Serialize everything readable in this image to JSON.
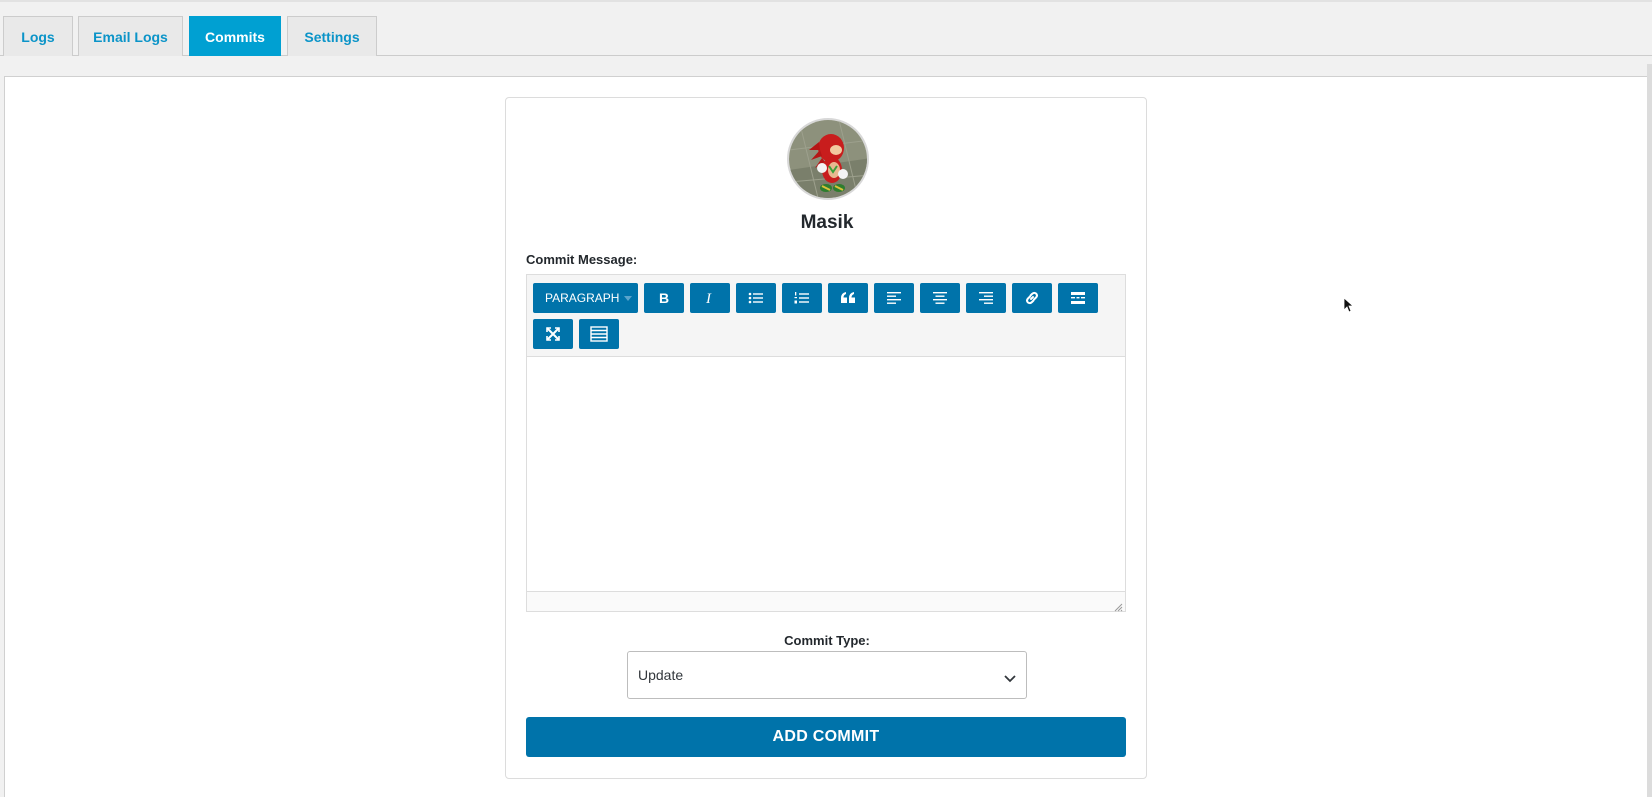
{
  "tabs": [
    {
      "label": "Logs",
      "active": false
    },
    {
      "label": "Email Logs",
      "active": false
    },
    {
      "label": "Commits",
      "active": true
    },
    {
      "label": "Settings",
      "active": false
    }
  ],
  "profile": {
    "username": "Masik"
  },
  "form": {
    "commit_message_label": "Commit Message:",
    "editor": {
      "format_select": "PARAGRAPH",
      "buttons": [
        "bold-icon",
        "italic-icon",
        "bulleted-list-icon",
        "numbered-list-icon",
        "blockquote-icon",
        "align-left-icon",
        "align-center-icon",
        "align-right-icon",
        "link-icon",
        "read-more-icon",
        "fullscreen-icon",
        "toolbar-toggle-icon"
      ],
      "content": ""
    },
    "commit_type_label": "Commit Type:",
    "commit_type_value": "Update",
    "submit_label": "ADD COMMIT"
  },
  "colors": {
    "accent": "#00a0d2",
    "primary_button": "#0073aa",
    "tab_text": "#0b94c8"
  }
}
